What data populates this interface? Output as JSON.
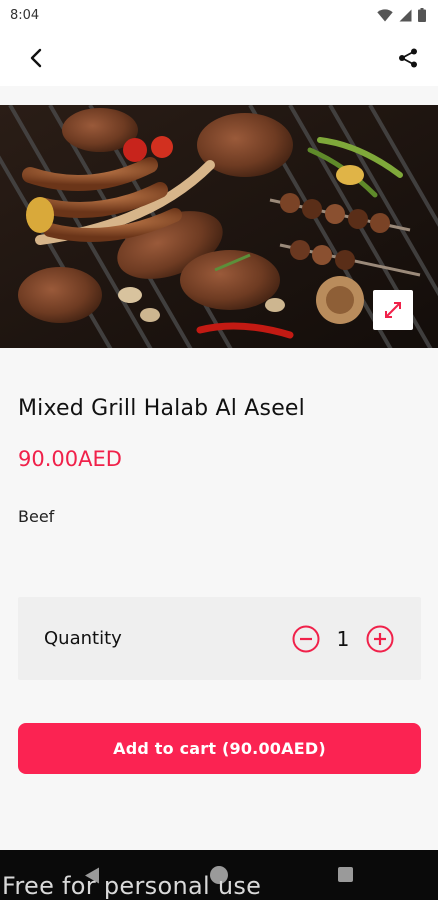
{
  "status_bar": {
    "time": "8:04",
    "icons": [
      "wifi-icon",
      "signal-icon",
      "battery-icon"
    ]
  },
  "toolbar": {
    "back_icon": "back-arrow-icon",
    "share_icon": "share-icon"
  },
  "hero": {
    "image": "mixed-grill-photo",
    "expand_icon": "expand-icon"
  },
  "product": {
    "title": "Mixed Grill Halab Al Aseel",
    "price": "90.00AED",
    "description": "Beef"
  },
  "quantity": {
    "label": "Quantity",
    "value": "1",
    "decrement_icon": "minus-circle-icon",
    "increment_icon": "plus-circle-icon"
  },
  "cart": {
    "add_label": "Add to cart (90.00AED)"
  },
  "nav_bar": {
    "icons": [
      "nav-back-icon",
      "nav-home-icon",
      "nav-recent-icon"
    ]
  },
  "watermark": "Free for personal use",
  "colors": {
    "accent": "#fb2352",
    "price": "#f0214a",
    "panel": "#efefef",
    "background": "#f7f7f7"
  }
}
